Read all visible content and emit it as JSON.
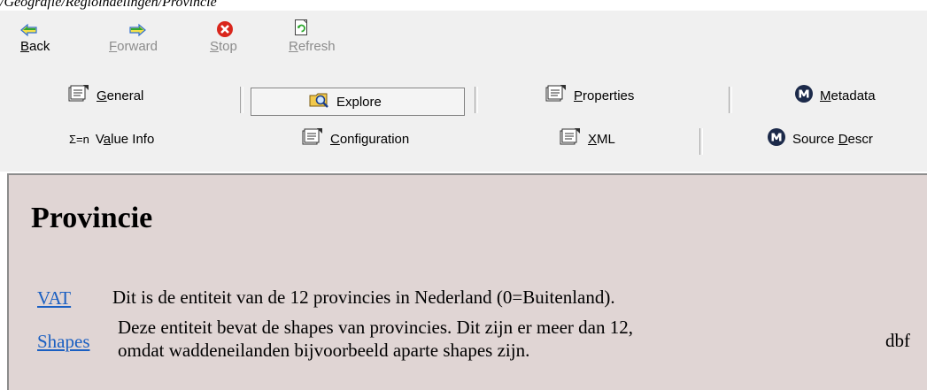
{
  "window": {
    "path": "/Geografie/Regioindelingen/Provincie"
  },
  "toolbar": {
    "back": {
      "label": "Back",
      "accel": "B",
      "rest": "ack"
    },
    "forward": {
      "label": "Forward",
      "accel": "F",
      "rest": "orward"
    },
    "stop": {
      "label": "Stop",
      "accel": "S",
      "rest": "top"
    },
    "refresh": {
      "label": "Refresh",
      "accel": "R",
      "rest": "efresh"
    }
  },
  "tabs": {
    "general": {
      "accel": "G",
      "rest": "eneral"
    },
    "explore": {
      "label": "Explore"
    },
    "properties": {
      "accel": "P",
      "rest": "roperties"
    },
    "metadata": {
      "accel": "M",
      "rest": "etadata"
    },
    "value_info": {
      "pre": "V",
      "accel": "a",
      "rest": "lue Info",
      "icon_text": "Σ=n"
    },
    "configuration": {
      "accel": "C",
      "rest": "onfiguration"
    },
    "xml": {
      "accel": "X",
      "rest": "ML"
    },
    "source_descr": {
      "pre": "Source ",
      "accel": "D",
      "rest": "escr"
    }
  },
  "content": {
    "title": "Provincie",
    "rows": [
      {
        "link": "VAT",
        "description": "Dit is de entiteit van de 12 provincies in Nederland (0=Buitenland).",
        "extra": ""
      },
      {
        "link": "Shapes",
        "description_line1": "Deze entiteit bevat de shapes van provincies. Dit zijn er meer dan 12,",
        "description_line2": "omdat waddeneilanden bijvoorbeeld aparte shapes zijn.",
        "extra": "dbf"
      }
    ]
  },
  "colors": {
    "content_bg": "#e0d5d4",
    "link": "#1a5fc2",
    "stop_red": "#d9261c",
    "nav_arrow_blue": "#2f6fd0",
    "nav_arrow_green": "#2fa82f"
  }
}
